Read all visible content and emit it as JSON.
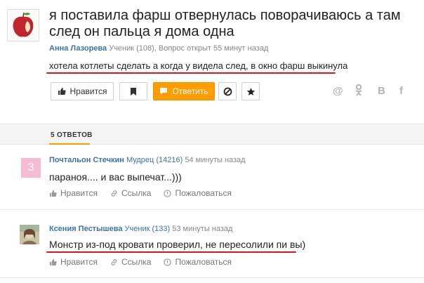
{
  "question": {
    "title": "я поставила фарш отвернулась поворачиваюсь а там след он пальца я дома одна",
    "author": "Анна Лазорева",
    "meta": "Ученик (108), Вопрос открыт 55 минут назад",
    "body": "хотела котлеты сделать а когда у видела след, в окно фарш выкинула",
    "avatar_icon": "apple-avatar",
    "accent_underline_color": "#d7191f"
  },
  "actions": {
    "like_label": "Нравится",
    "answer_label": "Ответить",
    "share_icons": [
      "at-icon",
      "odnoklassniki-icon",
      "vk-icon",
      "facebook-icon"
    ]
  },
  "answers_header": {
    "count_label": "5 ОТВЕТОВ"
  },
  "answers": [
    {
      "author": "Почтальон Стечкин",
      "rank": "Мудрец (14216)",
      "time": "54 минуты назад",
      "text": "параноя.... и вас выпечат...)))",
      "avatar_letter": "З",
      "like_label": "Нравится",
      "link_label": "Ссылка",
      "report_label": "Пожаловаться"
    },
    {
      "author": "Ксения Пестышева",
      "rank": "Ученик (133)",
      "time": "53 минуты назад",
      "text": "Монстр из-под кровати проверил, не пересолили пи вы)",
      "like_label": "Нравится",
      "link_label": "Ссылка",
      "report_label": "Пожаловаться"
    }
  ],
  "colors": {
    "brand_orange": "#ff9c00",
    "link_blue": "#3b73a8"
  }
}
